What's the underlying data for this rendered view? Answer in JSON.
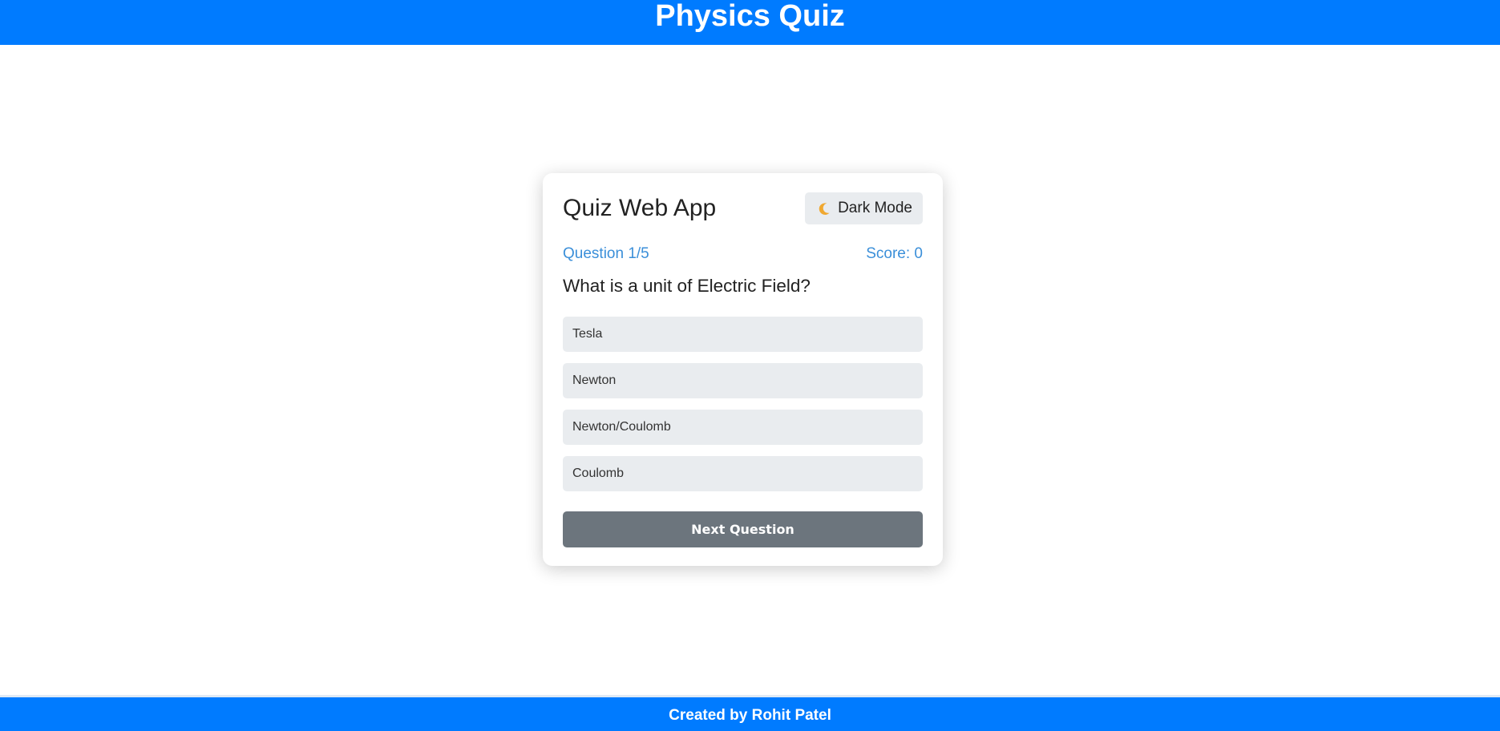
{
  "header": {
    "title": "Physics Quiz"
  },
  "card": {
    "app_title": "Quiz Web App",
    "dark_mode_label": "Dark Mode",
    "dark_mode_icon": "moon-icon",
    "question_counter": "Question 1/5",
    "score": "Score: 0",
    "question": "What is a unit of Electric Field?",
    "options": [
      "Tesla",
      "Newton",
      "Newton/Coulomb",
      "Coulomb"
    ],
    "next_label": "Next Question"
  },
  "footer": {
    "credit": "Created by Rohit Patel"
  },
  "colors": {
    "header_bg": "#007bff",
    "accent_text": "#3b8fd9",
    "option_bg": "#e9ecef",
    "next_button_bg": "#6c757d",
    "moon": "#f0a830"
  }
}
